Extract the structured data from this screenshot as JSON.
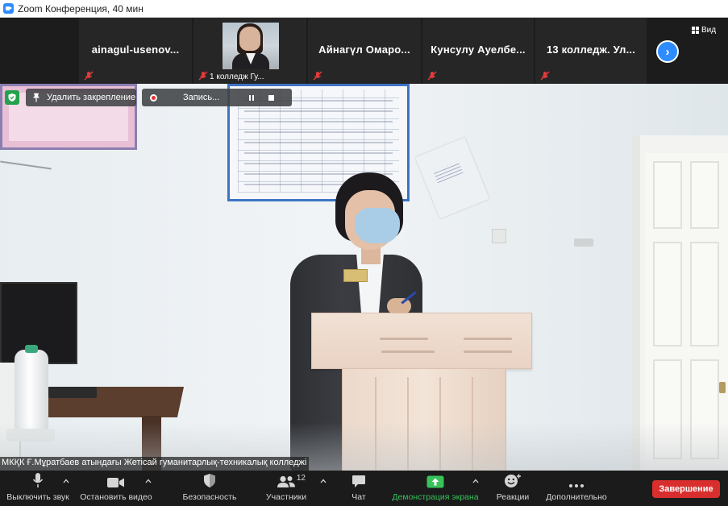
{
  "window": {
    "title": "Zoom Конференция, 40 мин"
  },
  "strip": {
    "participants": [
      {
        "name": "ainagul-usenov..."
      },
      {
        "sub": "1 колледж Гу..."
      },
      {
        "name": "Айнагүл  Омаро..."
      },
      {
        "name": "Кунсулу  Ауелбе..."
      },
      {
        "name": "13  колледж. Ул..."
      }
    ],
    "view_label": "Вид"
  },
  "overlay": {
    "unpin_label": "Удалить закрепление",
    "record_label": "Запись..."
  },
  "speaker": {
    "label": "МКҚК Ғ.Мұратбаев атындағы Жетісай гуманитарлық-техникалық колледжі"
  },
  "toolbar": {
    "mute_label": "Выключить звук",
    "video_label": "Остановить видео",
    "security_label": "Безопасность",
    "participants_label": "Участники",
    "participants_count": "12",
    "chat_label": "Чат",
    "share_label": "Демонстрация экрана",
    "reactions_label": "Реакции",
    "more_label": "Дополнительно",
    "end_label": "Завершение"
  },
  "colors": {
    "accent": "#2d8cff",
    "share_green": "#37c25a",
    "end_red": "#d92e2e",
    "security_green": "#23a24d"
  }
}
